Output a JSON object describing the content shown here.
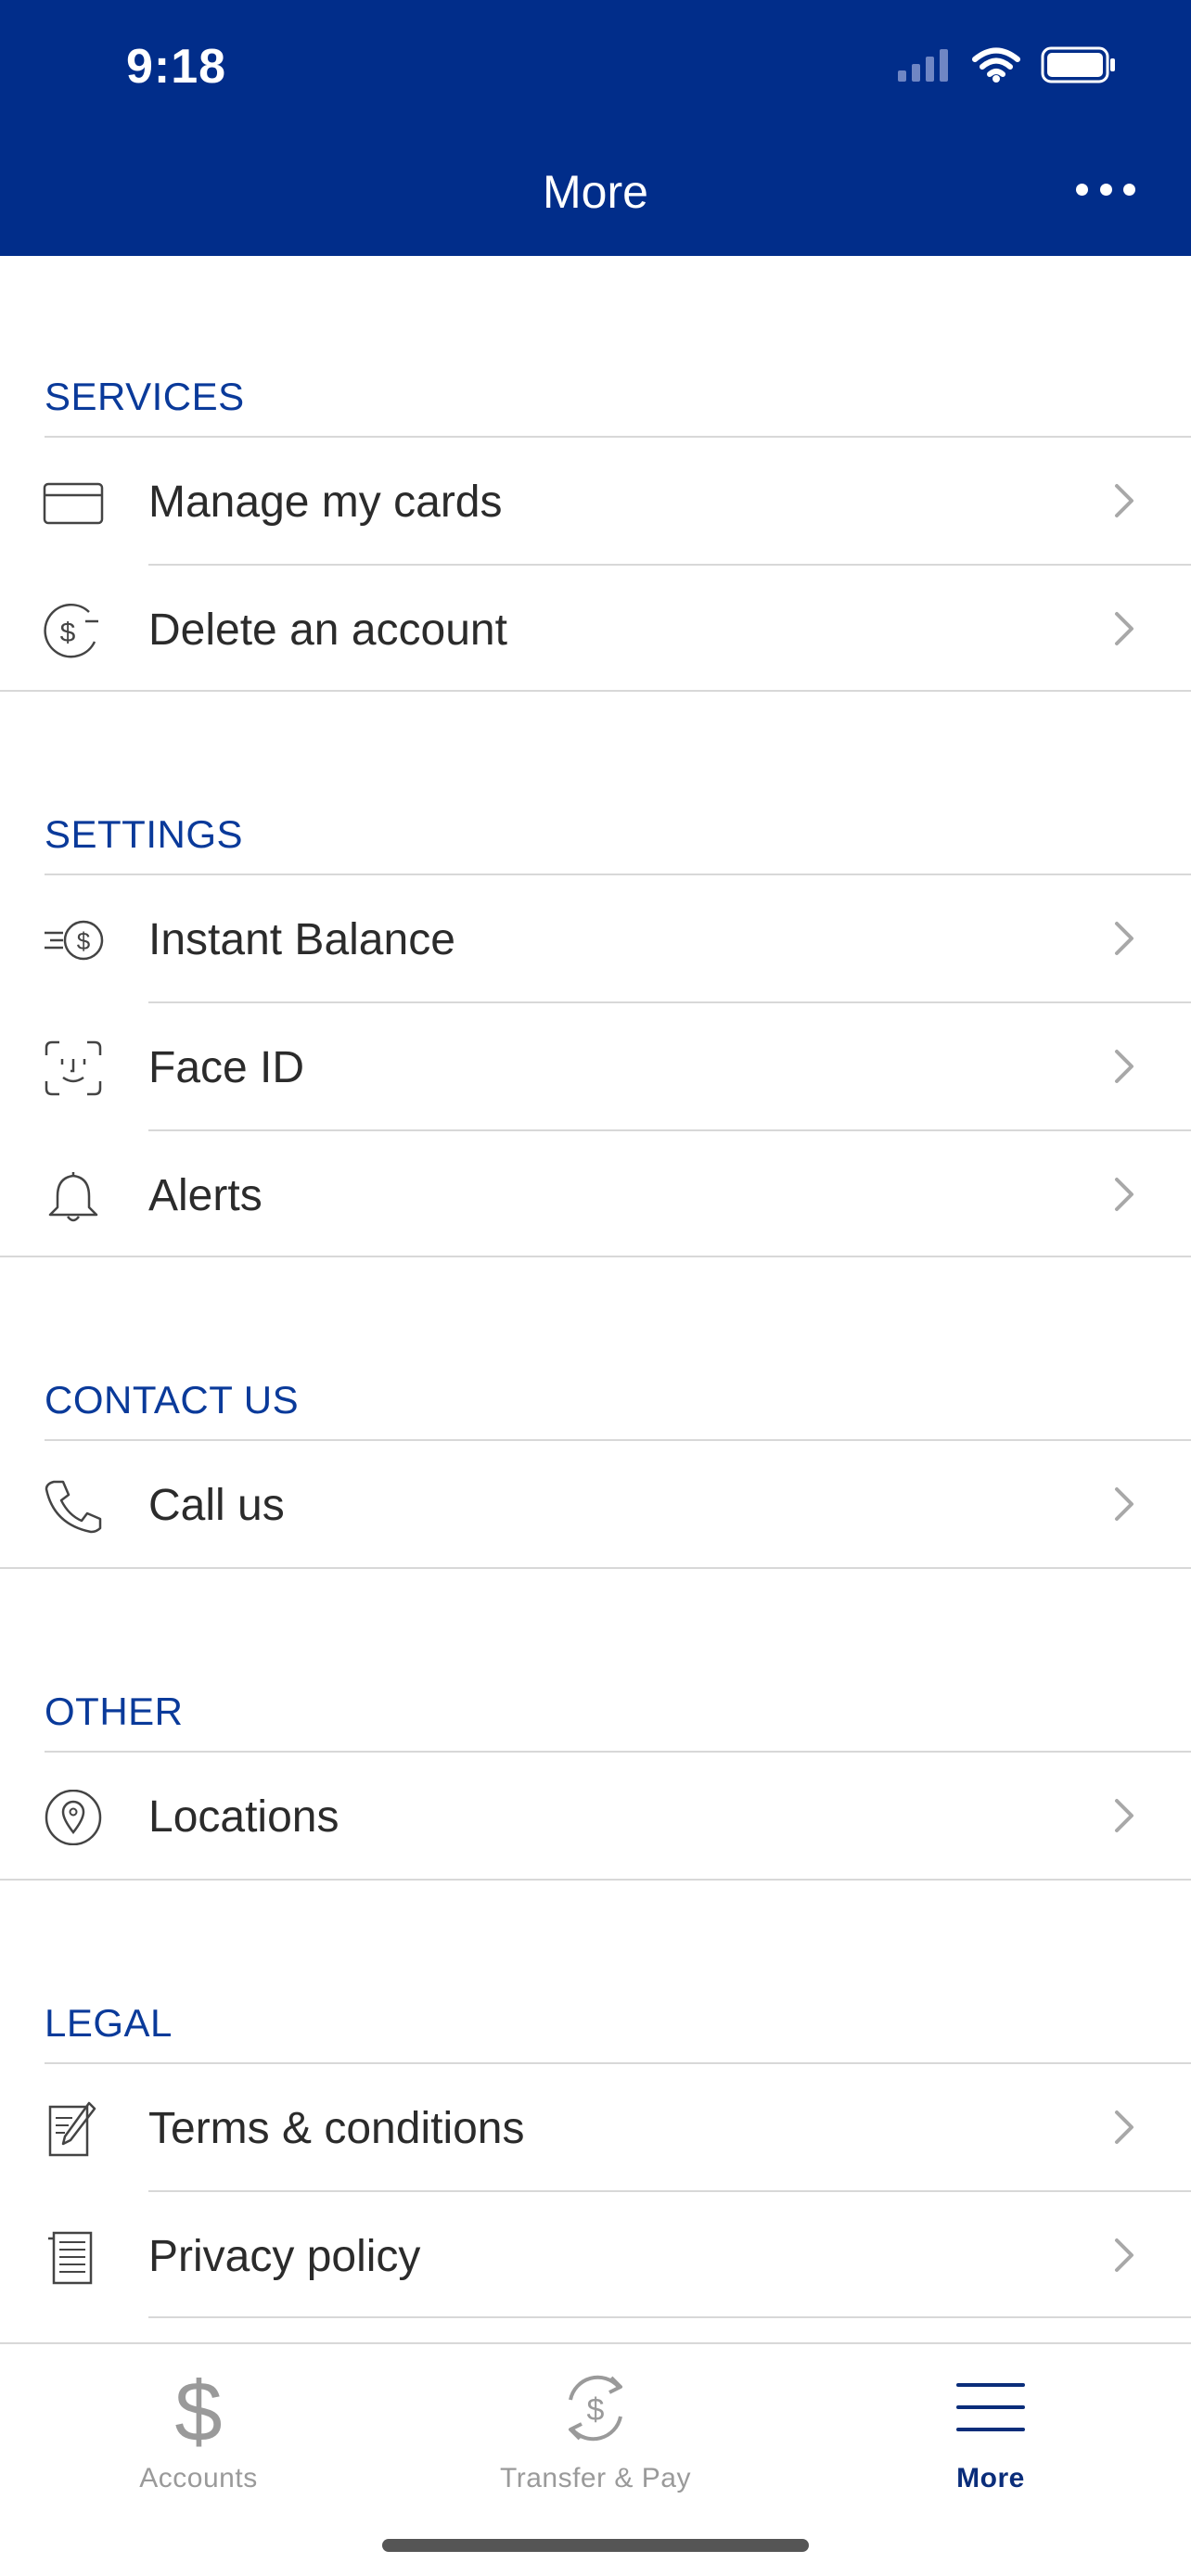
{
  "status_bar": {
    "time": "9:18"
  },
  "nav": {
    "title": "More"
  },
  "sections": {
    "services": {
      "title": "SERVICES",
      "items": [
        {
          "label": "Manage my cards",
          "icon": "credit-card-icon"
        },
        {
          "label": "Delete an account",
          "icon": "dollar-minus-icon"
        }
      ]
    },
    "settings": {
      "title": "SETTINGS",
      "items": [
        {
          "label": "Instant Balance",
          "icon": "fast-dollar-icon"
        },
        {
          "label": "Face ID",
          "icon": "face-id-icon"
        },
        {
          "label": "Alerts",
          "icon": "bell-icon"
        }
      ]
    },
    "contact": {
      "title": "CONTACT US",
      "items": [
        {
          "label": "Call us",
          "icon": "phone-icon"
        }
      ]
    },
    "other": {
      "title": "OTHER",
      "items": [
        {
          "label": "Locations",
          "icon": "location-pin-icon"
        }
      ]
    },
    "legal": {
      "title": "LEGAL",
      "items": [
        {
          "label": "Terms & conditions",
          "icon": "document-pen-icon"
        },
        {
          "label": "Privacy policy",
          "icon": "document-icon"
        }
      ]
    }
  },
  "tabbar": {
    "tabs": [
      {
        "label": "Accounts",
        "icon": "dollar-icon",
        "active": false
      },
      {
        "label": "Transfer & Pay",
        "icon": "transfer-dollar-icon",
        "active": false
      },
      {
        "label": "More",
        "icon": "menu-icon",
        "active": true
      }
    ]
  },
  "colors": {
    "header_bg": "#012d8a",
    "section_title": "#0a3a9a",
    "active_tab": "#0a2d7a",
    "inactive_tab": "#9a9a9a"
  }
}
